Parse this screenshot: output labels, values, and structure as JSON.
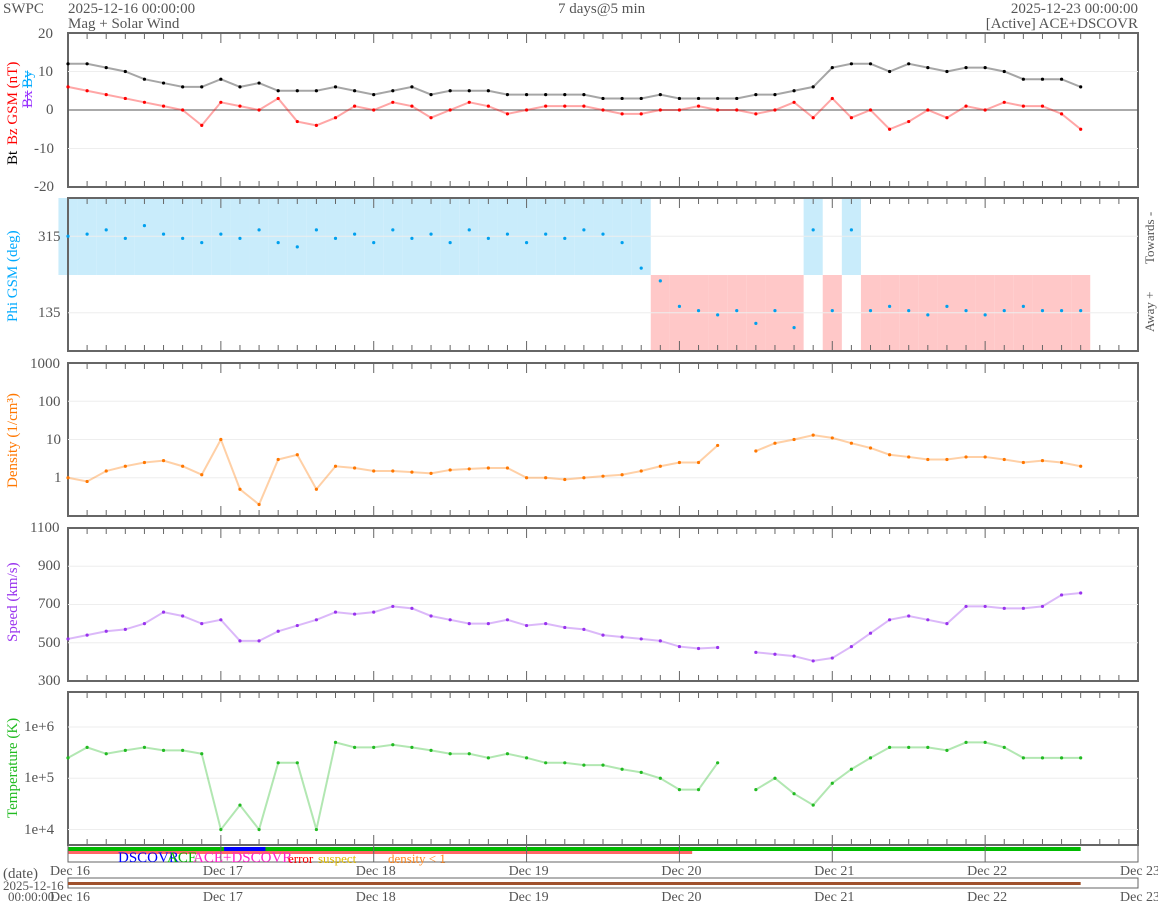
{
  "header": {
    "brand": "SWPC",
    "start_time": "2025-12-16 00:00:00",
    "product": "Mag + Solar Wind",
    "span": "7 days@5 min",
    "end_time": "2025-12-23 00:00:00",
    "source_status": "[Active] ACE+DSCOVR"
  },
  "colors": {
    "bt": "#000000",
    "bz": "#ff0000",
    "bx": "#9933ff",
    "by": "#00aaff",
    "phi": "#00a0ee",
    "towards": "#c9ecfb",
    "away": "#ffc8c8",
    "density": "#ff7700",
    "speed": "#9933ee",
    "temperature": "#22bb22",
    "dscovr": "#0000ff",
    "ace": "#00bb00",
    "ace_dscovr": "#ff22cc",
    "error": "#ff0000",
    "suspect": "#ddbb00",
    "density_lt1": "#ff8822",
    "timebar": "#a0522d"
  },
  "legend": {
    "dscovr": "DSCOVR",
    "ace": "ACE",
    "ace_dscovr": "ACE+DSCOVR",
    "error": "error",
    "suspect": "suspect",
    "density_lt1": "density < 1"
  },
  "date_axis": {
    "label": "(date)",
    "start_date": "2025-12-16",
    "start_clock": "00:00:00",
    "ticks": [
      "Dec 16",
      "Dec 17",
      "Dec 18",
      "Dec 19",
      "Dec 20",
      "Dec 21",
      "Dec 22",
      "Dec 23"
    ]
  },
  "chart_data": [
    {
      "type": "line",
      "title": "Bt / Bz GSM",
      "ylabel": "Bz GSM (nT)",
      "labels": {
        "bt": "Bt",
        "bz": "Bz GSM (nT)",
        "bx": "Bx",
        "by": "By"
      },
      "ylim": [
        -20,
        20
      ],
      "yticks": [
        "20",
        "10",
        "0",
        "-10",
        "-20"
      ],
      "grid": true,
      "x_hours": [
        0,
        3,
        6,
        9,
        12,
        15,
        18,
        21,
        24,
        27,
        30,
        33,
        36,
        39,
        42,
        45,
        48,
        51,
        54,
        57,
        60,
        63,
        66,
        69,
        72,
        75,
        78,
        81,
        84,
        87,
        90,
        93,
        96,
        99,
        102,
        105,
        108,
        111,
        114,
        117,
        120,
        123,
        126,
        129,
        132,
        135,
        138,
        141,
        144,
        147,
        150,
        153,
        156,
        159
      ],
      "series": [
        {
          "name": "Bt",
          "values": [
            12,
            12,
            11,
            10,
            8,
            7,
            6,
            6,
            8,
            6,
            7,
            5,
            5,
            5,
            6,
            5,
            4,
            5,
            6,
            4,
            5,
            5,
            5,
            4,
            4,
            4,
            4,
            4,
            3,
            3,
            3,
            4,
            3,
            3,
            3,
            3,
            4,
            4,
            5,
            6,
            11,
            12,
            12,
            10,
            12,
            11,
            10,
            11,
            11,
            10,
            8,
            8,
            8,
            6
          ]
        },
        {
          "name": "Bz GSM",
          "values": [
            6,
            5,
            4,
            3,
            2,
            1,
            0,
            -4,
            2,
            1,
            0,
            3,
            -3,
            -4,
            -2,
            1,
            0,
            2,
            1,
            -2,
            0,
            2,
            1,
            -1,
            0,
            1,
            1,
            1,
            0,
            -1,
            -1,
            0,
            0,
            1,
            0,
            0,
            -1,
            0,
            2,
            -2,
            3,
            -2,
            0,
            -5,
            -3,
            0,
            -2,
            1,
            0,
            2,
            1,
            1,
            -1,
            -5
          ]
        }
      ]
    },
    {
      "type": "scatter",
      "title": "Phi GSM",
      "ylabel": "Phi GSM (deg)",
      "ylim": [
        45,
        405
      ],
      "yticks": [
        "315",
        "135"
      ],
      "sector_labels": {
        "towards": "Towards -",
        "away": "Away +"
      },
      "series": [
        {
          "name": "Phi GSM",
          "values": [
            315,
            320,
            330,
            310,
            340,
            320,
            310,
            300,
            320,
            310,
            330,
            300,
            290,
            330,
            310,
            320,
            300,
            330,
            310,
            320,
            300,
            330,
            310,
            320,
            300,
            320,
            310,
            330,
            320,
            300,
            240,
            210,
            150,
            140,
            130,
            140,
            110,
            140,
            100,
            330,
            140,
            330,
            140,
            150,
            140,
            130,
            150,
            140,
            130,
            140,
            150,
            140,
            140,
            140
          ]
        }
      ]
    },
    {
      "type": "line",
      "title": "Density",
      "ylabel": "Density (1/cm³)",
      "yscale": "log",
      "ylim": [
        0.1,
        1000
      ],
      "yticks": [
        "1000",
        "100",
        "10",
        "1"
      ],
      "series": [
        {
          "name": "Density",
          "values": [
            1,
            0.8,
            1.5,
            2,
            2.5,
            2.8,
            2,
            1.2,
            10,
            0.5,
            0.2,
            3,
            4,
            0.5,
            2,
            1.8,
            1.5,
            1.5,
            1.4,
            1.3,
            1.6,
            1.7,
            1.8,
            1.8,
            1.0,
            1.0,
            0.9,
            1.0,
            1.1,
            1.2,
            1.5,
            2.0,
            2.5,
            2.5,
            7,
            null,
            5,
            8,
            10,
            13,
            11,
            8,
            6,
            4,
            3.5,
            3,
            3,
            3.5,
            3.5,
            3,
            2.5,
            2.8,
            2.5,
            2
          ]
        }
      ]
    },
    {
      "type": "line",
      "title": "Speed",
      "ylabel": "Speed (km/s)",
      "ylim": [
        300,
        1100
      ],
      "yticks": [
        "1100",
        "900",
        "700",
        "500",
        "300"
      ],
      "series": [
        {
          "name": "Speed",
          "values": [
            520,
            540,
            560,
            570,
            600,
            660,
            640,
            600,
            620,
            510,
            510,
            560,
            590,
            620,
            660,
            650,
            660,
            690,
            680,
            640,
            620,
            600,
            600,
            620,
            590,
            600,
            580,
            570,
            540,
            530,
            520,
            510,
            480,
            470,
            475,
            null,
            450,
            440,
            430,
            405,
            420,
            480,
            550,
            620,
            640,
            620,
            600,
            690,
            690,
            680,
            680,
            690,
            750,
            760
          ]
        }
      ]
    },
    {
      "type": "line",
      "title": "Temperature",
      "ylabel": "Temperature (K)",
      "yscale": "log",
      "ylim": [
        5000,
        4800000
      ],
      "yticks": [
        "1e+6",
        "1e+5",
        "1e+4"
      ],
      "series": [
        {
          "name": "Temperature",
          "values": [
            250000,
            400000,
            300000,
            350000,
            400000,
            350000,
            350000,
            300000,
            10000,
            30000,
            10000,
            200000,
            200000,
            10000,
            500000,
            400000,
            400000,
            450000,
            400000,
            350000,
            300000,
            300000,
            250000,
            300000,
            250000,
            200000,
            200000,
            180000,
            180000,
            150000,
            130000,
            100000,
            60000,
            60000,
            200000,
            null,
            60000,
            100000,
            50000,
            30000,
            80000,
            150000,
            250000,
            400000,
            400000,
            400000,
            350000,
            500000,
            500000,
            400000,
            250000,
            250000,
            250000,
            250000
          ]
        }
      ]
    }
  ]
}
